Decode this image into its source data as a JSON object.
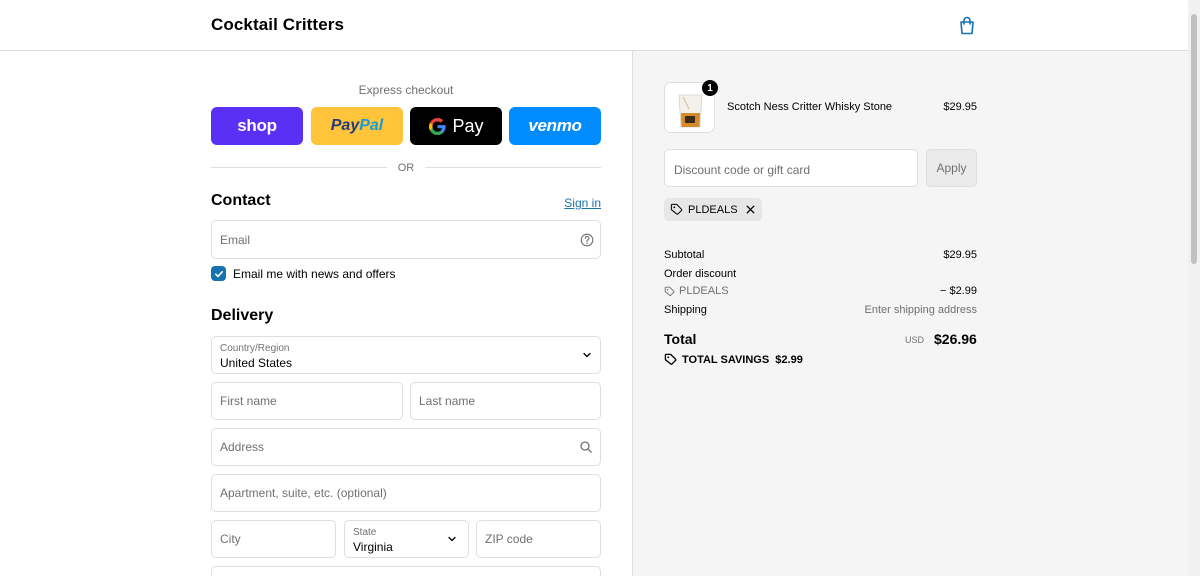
{
  "header": {
    "brand": "Cocktail Critters",
    "cart_icon": "shopping-bag-icon"
  },
  "express": {
    "title": "Express checkout",
    "buttons": {
      "shop": "shop",
      "paypal_a": "Pay",
      "paypal_b": "Pal",
      "gpay": "Pay",
      "venmo": "venmo"
    },
    "or": "OR"
  },
  "contact": {
    "title": "Contact",
    "sign_in": "Sign in",
    "email_placeholder": "Email",
    "newsletter_label": "Email me with news and offers",
    "newsletter_checked": true
  },
  "delivery": {
    "title": "Delivery",
    "country_label": "Country/Region",
    "country_value": "United States",
    "first_name_placeholder": "First name",
    "last_name_placeholder": "Last name",
    "address_placeholder": "Address",
    "apartment_placeholder": "Apartment, suite, etc. (optional)",
    "city_placeholder": "City",
    "state_label": "State",
    "state_value": "Virginia",
    "zip_placeholder": "ZIP code"
  },
  "order": {
    "item": {
      "quantity": "1",
      "name": "Scotch Ness Critter Whisky Stone",
      "price": "$29.95"
    },
    "discount_placeholder": "Discount code or gift card",
    "apply_label": "Apply",
    "applied_code": "PLDEALS",
    "summary": {
      "subtotal_label": "Subtotal",
      "subtotal_value": "$29.95",
      "discount_label": "Order discount",
      "discount_code": "PLDEALS",
      "discount_value": "− $2.99",
      "shipping_label": "Shipping",
      "shipping_value": "Enter shipping address",
      "total_label": "Total",
      "total_currency": "USD",
      "total_value": "$26.96",
      "savings": "TOTAL SAVINGS  $2.99"
    }
  },
  "colors": {
    "accent": "#1773b0",
    "shop": "#5a31f4",
    "paypal": "#ffc439",
    "gpay": "#000000",
    "venmo": "#008cff"
  }
}
